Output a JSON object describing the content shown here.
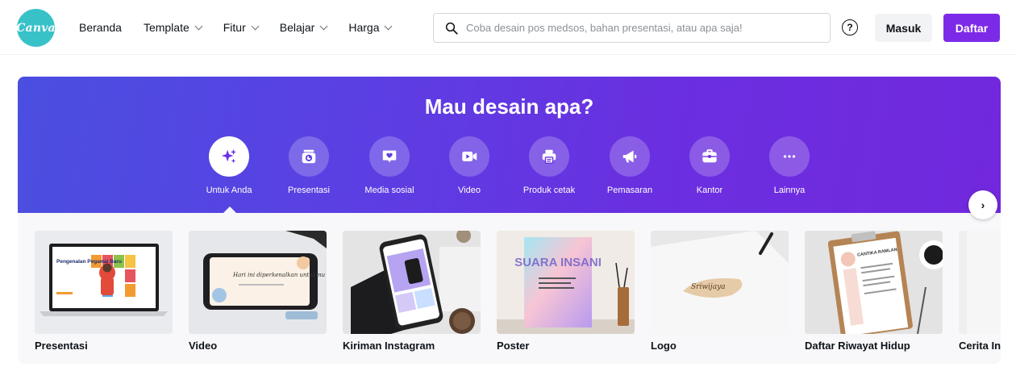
{
  "brand": {
    "logo_text": "Canva",
    "logo_color": "#38c2c8",
    "accent": "#7d2ae8"
  },
  "nav": {
    "items": [
      {
        "label": "Beranda",
        "dropdown": false
      },
      {
        "label": "Template",
        "dropdown": true
      },
      {
        "label": "Fitur",
        "dropdown": true
      },
      {
        "label": "Belajar",
        "dropdown": true
      },
      {
        "label": "Harga",
        "dropdown": true
      }
    ]
  },
  "search": {
    "placeholder": "Coba desain pos medsos, bahan presentasi, atau apa saja!",
    "value": ""
  },
  "header": {
    "help_icon": "?",
    "login_label": "Masuk",
    "signup_label": "Daftar"
  },
  "hero": {
    "title": "Mau desain apa?",
    "categories": [
      {
        "label": "Untuk Anda",
        "icon": "sparkle-icon",
        "active": true
      },
      {
        "label": "Presentasi",
        "icon": "presentation-icon",
        "active": false
      },
      {
        "label": "Media sosial",
        "icon": "heart-chat-icon",
        "active": false
      },
      {
        "label": "Video",
        "icon": "video-camera-icon",
        "active": false
      },
      {
        "label": "Produk cetak",
        "icon": "printer-icon",
        "active": false
      },
      {
        "label": "Pemasaran",
        "icon": "megaphone-icon",
        "active": false
      },
      {
        "label": "Kantor",
        "icon": "briefcase-icon",
        "active": false
      },
      {
        "label": "Lainnya",
        "icon": "more-icon",
        "active": false
      }
    ]
  },
  "templates": {
    "items": [
      {
        "label": "Presentasi",
        "thumb_text": "Pengenalan Pegawai Baru"
      },
      {
        "label": "Video",
        "thumb_text": "Hari ini diperkenalkan untukmu"
      },
      {
        "label": "Kiriman Instagram",
        "thumb_text": ""
      },
      {
        "label": "Poster",
        "thumb_text": "SUARA INSANI"
      },
      {
        "label": "Logo",
        "thumb_text": "Sriwijaya"
      },
      {
        "label": "Daftar Riwayat Hidup",
        "thumb_text": "CANTIKA RAMLAN"
      },
      {
        "label": "Cerita In",
        "thumb_text": ""
      }
    ],
    "next_label": "›"
  }
}
